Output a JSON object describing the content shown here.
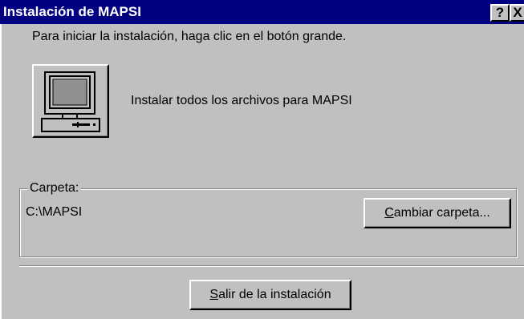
{
  "window": {
    "title": "Instalación de MAPSI",
    "help_button": "?",
    "close_button": "X"
  },
  "main": {
    "instruction": "Para iniciar la instalación, haga clic en el botón grande.",
    "install_icon": "computer-icon",
    "install_label": "Instalar todos los archivos para MAPSI"
  },
  "folder_group": {
    "label": "Carpeta:",
    "path": "C:\\MAPSI",
    "change_button": {
      "mnemonic": "C",
      "rest": "ambiar carpeta..."
    }
  },
  "footer": {
    "exit_button": {
      "mnemonic": "S",
      "rest": "alir de la instalación"
    }
  },
  "colors": {
    "titlebar": "#000080",
    "face": "#c0c0c0",
    "screen": "#808080"
  }
}
